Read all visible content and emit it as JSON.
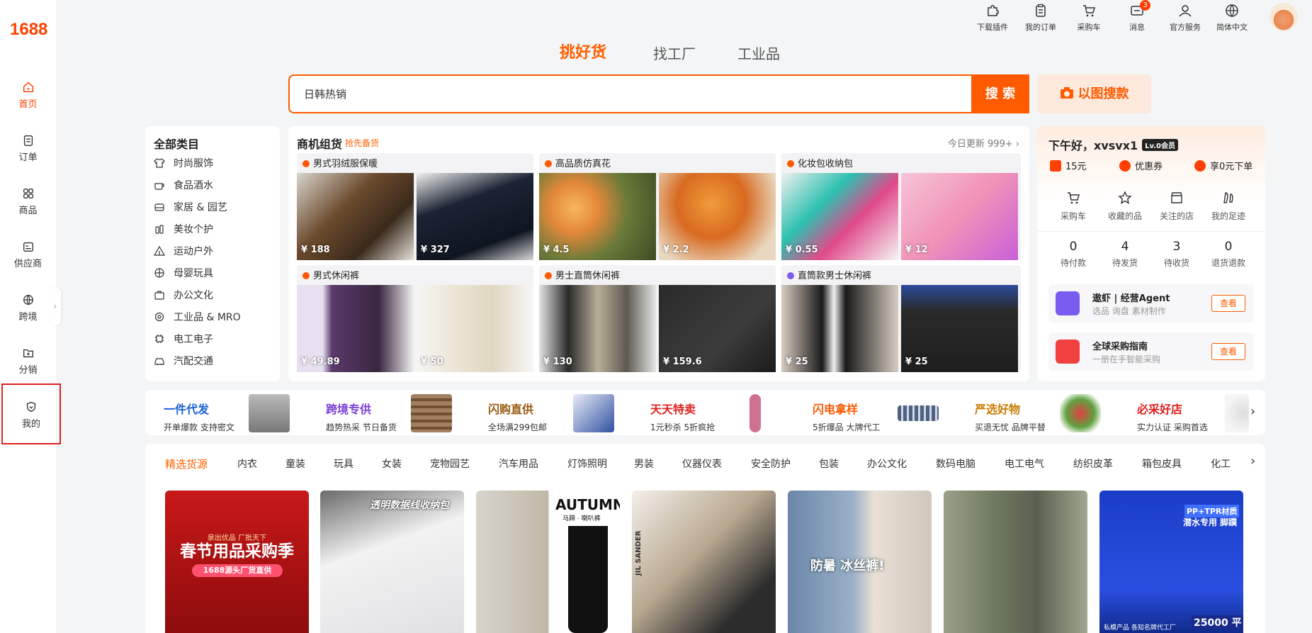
{
  "brand": {
    "logo": "1688"
  },
  "sidebar": {
    "items": [
      {
        "label": "首页",
        "icon": "home-icon"
      },
      {
        "label": "订单",
        "icon": "order-icon"
      },
      {
        "label": "商品",
        "icon": "grid-icon"
      },
      {
        "label": "供应商",
        "icon": "supplier-icon"
      },
      {
        "label": "跨境",
        "icon": "globe-icon"
      },
      {
        "label": "分销",
        "icon": "distribution-icon"
      },
      {
        "label": "我的",
        "icon": "heart-shield-icon"
      }
    ],
    "collapse_glyph": "›"
  },
  "topbar": {
    "items": [
      {
        "label": "下载插件",
        "icon": "puzzle-icon"
      },
      {
        "label": "我的订单",
        "icon": "clipboard-icon"
      },
      {
        "label": "采购车",
        "icon": "cart-icon"
      },
      {
        "label": "消息",
        "icon": "message-icon",
        "badge": "3"
      },
      {
        "label": "官方服务",
        "icon": "user-icon"
      },
      {
        "label": "简体中文",
        "icon": "globe-icon"
      }
    ]
  },
  "search": {
    "tabs": [
      "挑好货",
      "找工厂",
      "工业品"
    ],
    "value": "日韩热销",
    "button": "搜 索",
    "image_search": "以图搜款"
  },
  "categories": {
    "title": "全部类目",
    "items": [
      "时尚服饰",
      "食品酒水",
      "家居 & 园艺",
      "美妆个护",
      "运动户外",
      "母婴玩具",
      "办公文化",
      "工业品 & MRO",
      "电工电子",
      "汽配交通"
    ]
  },
  "hot": {
    "title": "商机组货",
    "subtitle": "抢先备货",
    "update": "今日更新 999+ ›",
    "groups": [
      {
        "title": "男式羽绒服保暖",
        "prices": [
          "¥ 188",
          "¥ 327"
        ]
      },
      {
        "title": "高品质仿真花",
        "prices": [
          "¥ 4.5",
          "¥ 2.2"
        ]
      },
      {
        "title": "化妆包收纳包",
        "prices": [
          "¥ 0.55",
          "¥ 12"
        ]
      },
      {
        "title": "男式休闲裤",
        "prices": [
          "¥ 49.89",
          "¥ 50"
        ]
      },
      {
        "title": "男士直筒休闲裤",
        "prices": [
          "¥ 130",
          "¥ 159.6"
        ]
      },
      {
        "title": "直筒款男士休闲裤",
        "prices": [
          "¥ 25",
          "¥ 25"
        ]
      }
    ]
  },
  "user": {
    "greeting": "下午好，xvsvx1",
    "level": "Lv.0会员",
    "perks": [
      "15元",
      "优惠券",
      "享0元下单"
    ],
    "quick": [
      "采购车",
      "收藏的品",
      "关注的店",
      "我的足迹"
    ],
    "stats": [
      {
        "n": "0",
        "l": "待付款"
      },
      {
        "n": "4",
        "l": "待发货"
      },
      {
        "n": "3",
        "l": "待收货"
      },
      {
        "n": "0",
        "l": "退货退款"
      }
    ],
    "services": [
      {
        "title": "遨虾 | 经营Agent",
        "sub": "选品 询盘 素材制作",
        "btn": "查看"
      },
      {
        "title": "全球采购指南",
        "sub": "一册在手智能采购",
        "btn": "查看"
      }
    ]
  },
  "promos": [
    {
      "title": "一件代发",
      "sub": "开单爆款 支持密文",
      "color": "#1a5fd6"
    },
    {
      "title": "跨境专供",
      "sub": "趋势热采 节日备货",
      "color": "#7a3fd8"
    },
    {
      "title": "闪购直供",
      "sub": "全场满299包邮",
      "color": "#9a5a10"
    },
    {
      "title": "天天特卖",
      "sub": "1元秒杀 5折疯抢",
      "color": "#e02020"
    },
    {
      "title": "闪电拿样",
      "sub": "5折爆品 大牌代工",
      "color": "#ff5a00"
    },
    {
      "title": "严选好物",
      "sub": "买退无忧 品牌平替",
      "color": "#c87b00"
    },
    {
      "title": "必采好店",
      "sub": "实力认证 采购首选",
      "color": "#e02020"
    }
  ],
  "cat_tabs": [
    "精选货源",
    "内衣",
    "童装",
    "玩具",
    "女装",
    "宠物园艺",
    "汽车用品",
    "灯饰照明",
    "男装",
    "仪器仪表",
    "安全防护",
    "包装",
    "办公文化",
    "数码电脑",
    "电工电气",
    "纺织皮革",
    "箱包皮具",
    "化工"
  ],
  "cards": {
    "c1_small": "泉出优品 厂批天下",
    "c1_big": "春节用品采购季",
    "c1_tag": "1688源头厂货直供",
    "c2_text": "透明数据线收纳包",
    "c3_text": "AUTUMN",
    "c3_sub": "马蹄 · 喇叭裤",
    "c4_text": "JIL SANDER",
    "c5_text": "防暑 冰丝裤!",
    "c7_badge": "PP+TPR材质",
    "c7_sub": "潜水专用 脚蹼",
    "c7_price": "25000 平",
    "c7_footer": "私模产品 各知名牌代工厂"
  },
  "colors": {
    "accent": "#ff5a00",
    "brand": "#ff4000"
  }
}
